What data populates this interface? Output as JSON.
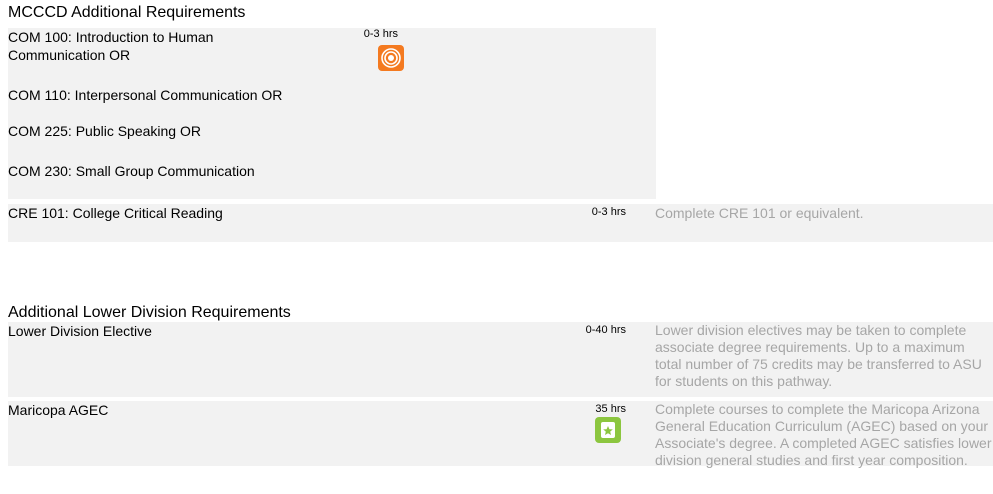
{
  "sections": [
    {
      "title": "MCCCD Additional Requirements",
      "group": {
        "courses": [
          "COM 100: Introduction to Human Communication OR",
          "COM 110: Interpersonal Communication OR",
          "COM 225: Public Speaking OR",
          "COM 230: Small Group Communication"
        ],
        "hours": "0-3 hrs",
        "icon": "orange-swirl-icon"
      },
      "rows": [
        {
          "course": "CRE 101: College Critical Reading",
          "hours": "0-3 hrs",
          "note": "Complete CRE 101 or equivalent."
        }
      ]
    },
    {
      "title": "Additional Lower Division Requirements",
      "rows": [
        {
          "course": "Lower Division Elective",
          "hours": "0-40 hrs",
          "note": "Lower division electives may be taken to complete associate degree requirements. Up to a maximum total number of 75 credits may be transferred to ASU for students on this pathway."
        },
        {
          "course": "Maricopa AGEC",
          "hours": "35 hrs",
          "icon": "green-star-icon",
          "note": "Complete courses to complete the Maricopa Arizona General Education Curriculum (AGEC) based on your Associate's degree. A completed AGEC satisfies lower division general studies and first year composition."
        }
      ]
    }
  ],
  "colors": {
    "row_bg": "#f2f2f2",
    "note_text": "#a6a6a6",
    "icon_orange": "#f47a20",
    "icon_green": "#8cc63f"
  }
}
